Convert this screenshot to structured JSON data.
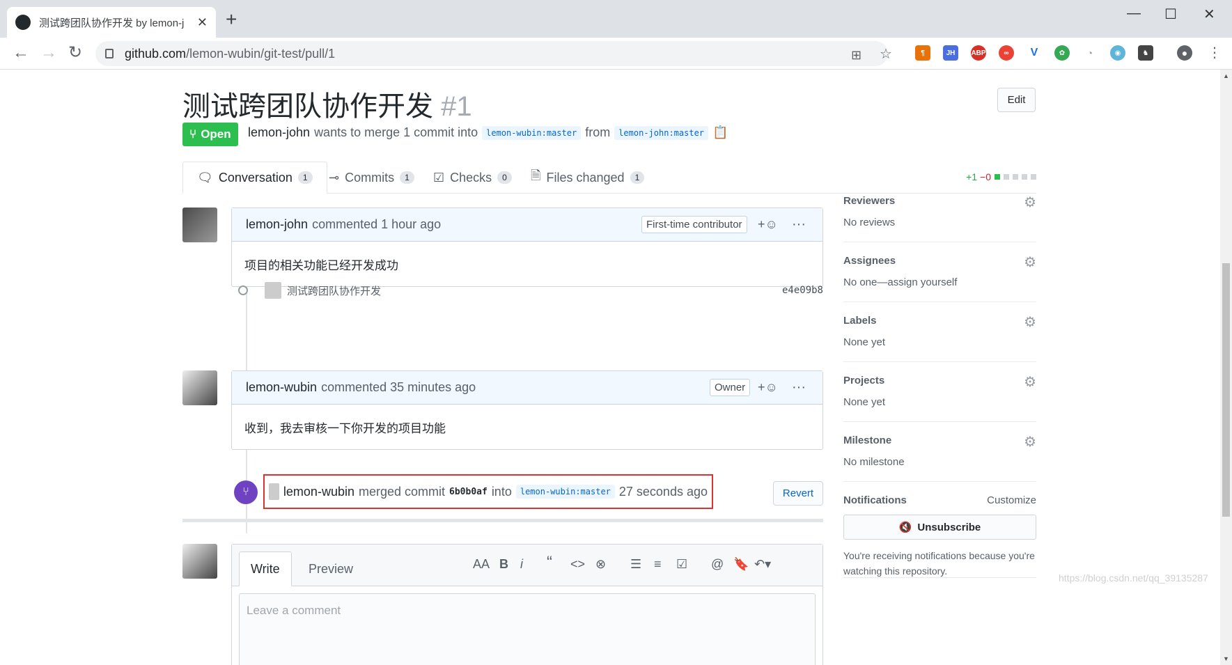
{
  "browser": {
    "tab_title": "测试跨团队协作开发 by lemon-j",
    "tab_close": "✕",
    "new_tab": "+",
    "url_host": "github.com",
    "url_path": "/lemon-wubin/git-test/pull/1"
  },
  "pr": {
    "title": "测试跨团队协作开发",
    "number": "#1",
    "edit_label": "Edit",
    "state": "Open",
    "author": "lemon-john",
    "merge_text": "wants to merge 1 commit into",
    "base_branch": "lemon-wubin:master",
    "from_text": "from",
    "head_branch": "lemon-john:master"
  },
  "tabs": [
    {
      "label": "Conversation",
      "count": "1"
    },
    {
      "label": "Commits",
      "count": "1"
    },
    {
      "label": "Checks",
      "count": "0"
    },
    {
      "label": "Files changed",
      "count": "1"
    }
  ],
  "diffstat": {
    "additions": "+1",
    "deletions": "−0"
  },
  "timeline": {
    "comment1": {
      "author": "lemon-john",
      "action": "commented 1 hour ago",
      "role": "First-time contributor",
      "body": "项目的相关功能已经开发成功"
    },
    "commit": {
      "message": "测试跨团队协作开发",
      "sha": "e4e09b8"
    },
    "comment2": {
      "author": "lemon-wubin",
      "action": "commented 35 minutes ago",
      "role": "Owner",
      "body": "收到，我去审核一下你开发的项目功能"
    },
    "merge": {
      "author": "lemon-wubin",
      "action": "merged commit",
      "sha": "6b0b0af",
      "into": "into",
      "branch": "lemon-wubin:master",
      "time": "27 seconds ago",
      "revert_label": "Revert"
    }
  },
  "editor": {
    "write_tab": "Write",
    "preview_tab": "Preview",
    "placeholder": "Leave a comment"
  },
  "sidebar": {
    "reviewers": {
      "title": "Reviewers",
      "value": "No reviews"
    },
    "assignees": {
      "title": "Assignees",
      "value": "No one—assign yourself"
    },
    "labels": {
      "title": "Labels",
      "value": "None yet"
    },
    "projects": {
      "title": "Projects",
      "value": "None yet"
    },
    "milestone": {
      "title": "Milestone",
      "value": "No milestone"
    },
    "notifications": {
      "title": "Notifications",
      "customize": "Customize",
      "unsubscribe": "Unsubscribe",
      "reason": "You're receiving notifications because you're watching this repository."
    }
  },
  "watermark": "https://blog.csdn.net/qq_39135287",
  "colors": {
    "open_green": "#2cbe4e",
    "merge_purple": "#6f42c1",
    "link_blue": "#0366d6",
    "highlight_red": "#e03131"
  }
}
